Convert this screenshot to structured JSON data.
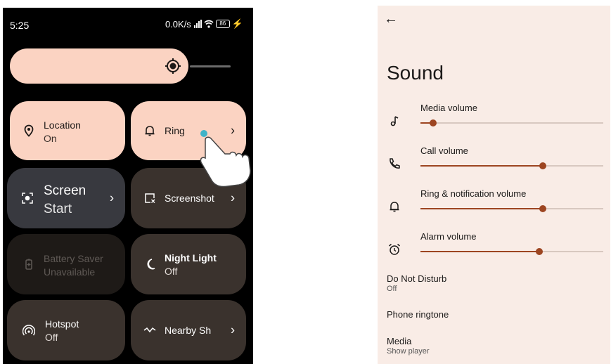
{
  "quick_settings": {
    "status": {
      "time": "5:25",
      "speed": "0.0K/s",
      "battery": "86"
    },
    "tiles": {
      "location": {
        "title": "Location",
        "sub": "On"
      },
      "ring": {
        "title": "Ring"
      },
      "screen": {
        "title": "Screen",
        "sub": "Start"
      },
      "screenshot": {
        "title": "Screenshot"
      },
      "battery_saver": {
        "title": "Battery Saver",
        "sub": "Unavailable"
      },
      "night_light": {
        "title": "Night Light",
        "sub": "Off"
      },
      "hotspot": {
        "title": "Hotspot",
        "sub": "Off"
      },
      "nearby": {
        "title": "Nearby Sh"
      }
    },
    "brightness_level": 0.81
  },
  "sound": {
    "title": "Sound",
    "volumes": [
      {
        "label": "Media volume",
        "level": 0.07,
        "icon": "music-note-icon"
      },
      {
        "label": "Call volume",
        "level": 0.67,
        "icon": "phone-icon"
      },
      {
        "label": "Ring & notification volume",
        "level": 0.67,
        "icon": "bell-icon"
      },
      {
        "label": "Alarm volume",
        "level": 0.65,
        "icon": "alarm-icon"
      }
    ],
    "dnd": {
      "title": "Do Not Disturb",
      "sub": "Off"
    },
    "ringtone": {
      "title": "Phone ringtone"
    },
    "media": {
      "title": "Media",
      "sub": "Show player"
    }
  },
  "colors": {
    "tile_light": "#fbd3c2",
    "tile_dark": "#3a322d",
    "accent": "#9d4521",
    "sound_bg": "#f9ece6"
  }
}
